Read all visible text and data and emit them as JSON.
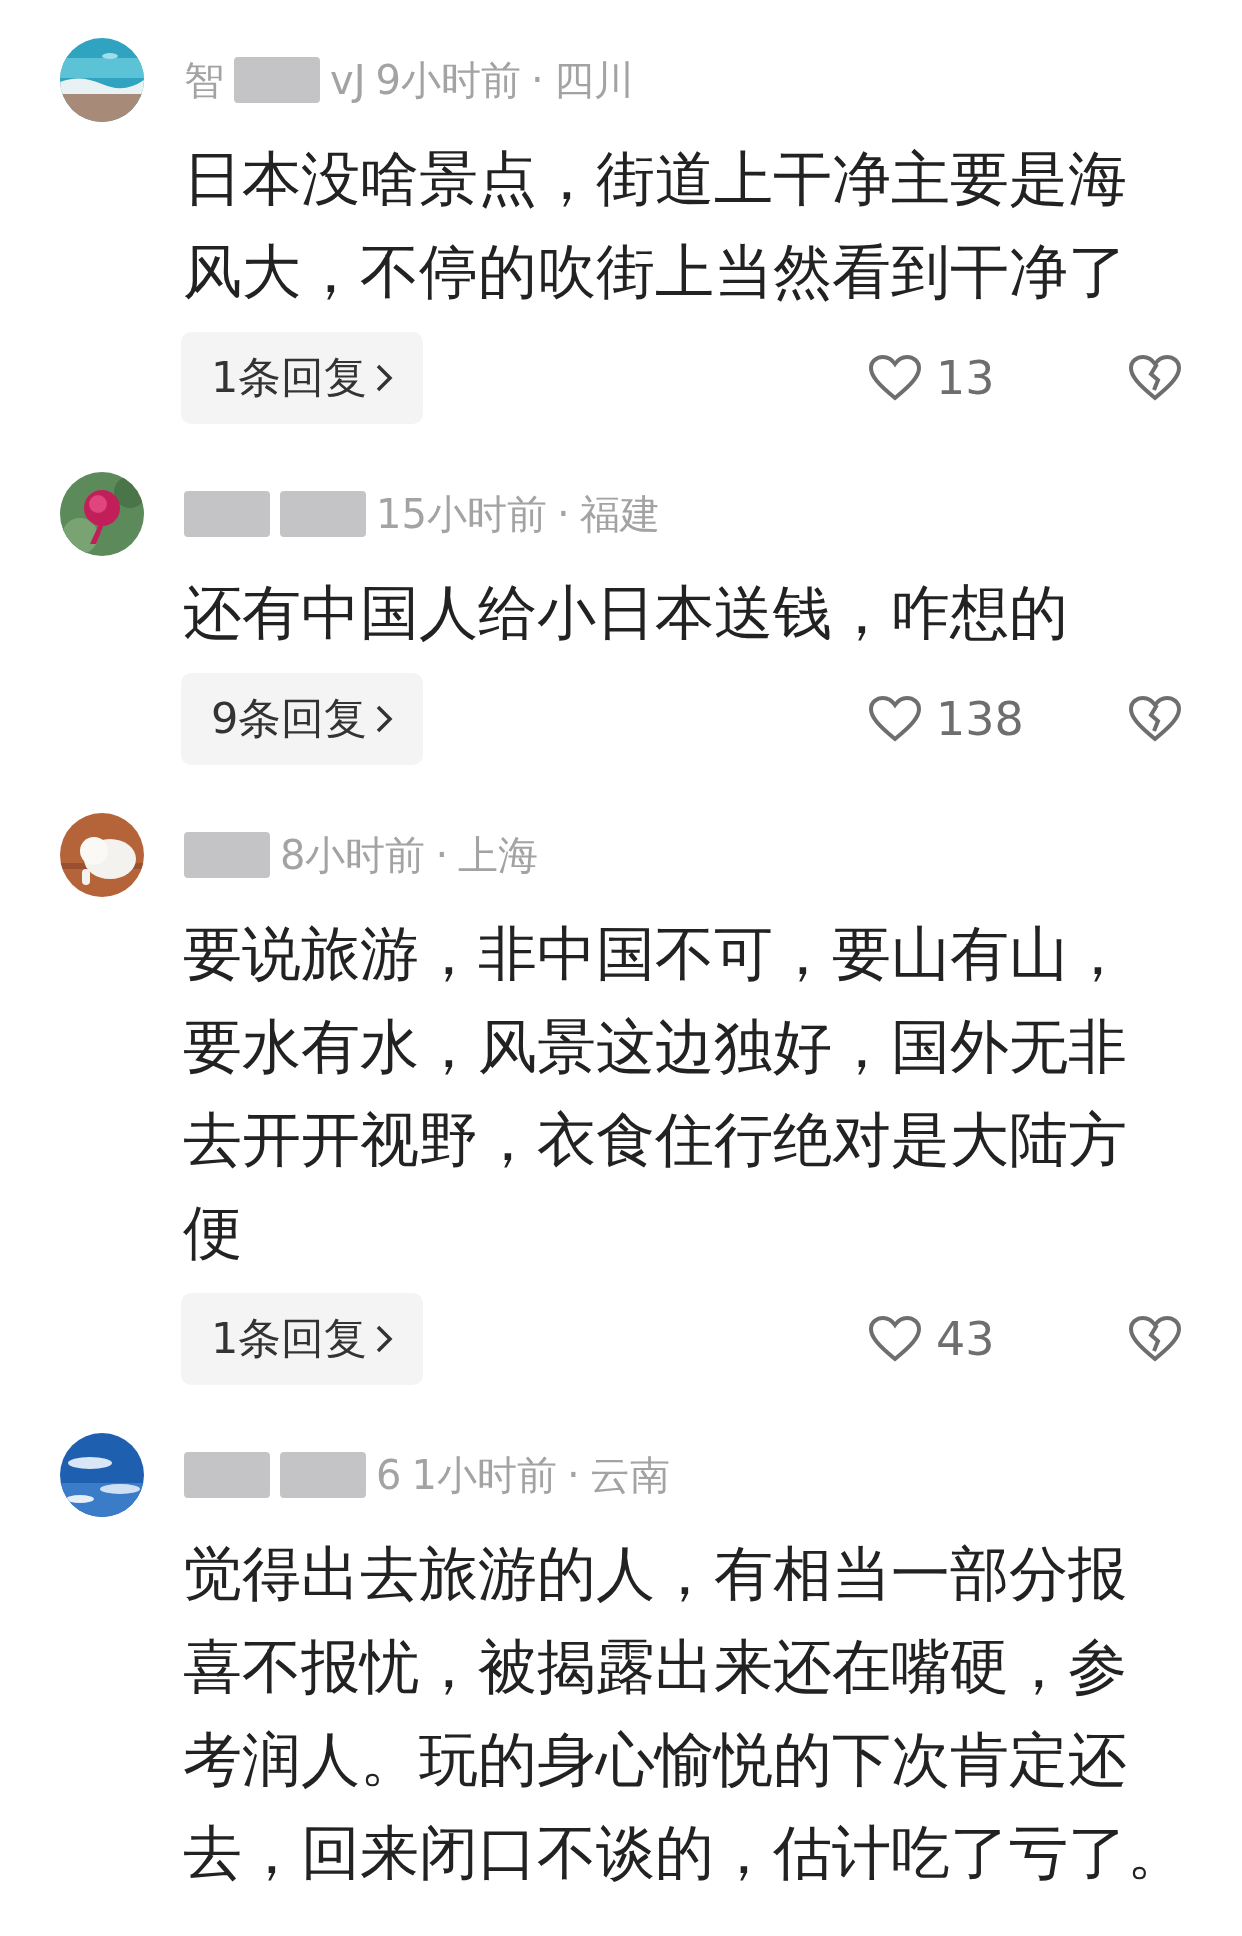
{
  "comments": [
    {
      "avatar": {
        "kind": "picture"
      },
      "name_parts": [
        {
          "kind": "text",
          "text": "智"
        },
        {
          "kind": "redacted"
        },
        {
          "kind": "text",
          "text": "vJ"
        }
      ],
      "time": "9小时前",
      "separator": "·",
      "location": "四川",
      "body_lines": [
        "日本没啥景点，街道上干净主要是海",
        "风大，不停的吹街上当然看到干净了"
      ],
      "replies": "1条回复",
      "likes": "13"
    },
    {
      "avatar": {
        "kind": "picture"
      },
      "name_parts": [
        {
          "kind": "redacted"
        },
        {
          "kind": "redacted"
        }
      ],
      "time": "15小时前",
      "separator": "·",
      "location": "福建",
      "body_lines": [
        "还有中国人给小日本送钱，咋想的"
      ],
      "replies": "9条回复",
      "likes": "138"
    },
    {
      "avatar": {
        "kind": "picture"
      },
      "name_parts": [
        {
          "kind": "redacted"
        }
      ],
      "time": "8小时前",
      "separator": "·",
      "location": "上海",
      "body_lines": [
        "要说旅游，非中国不可，要山有山，",
        "要水有水，风景这边独好，国外无非",
        "去开开视野，衣食住行绝对是大陆方",
        "便"
      ],
      "replies": "1条回复",
      "likes": "43"
    },
    {
      "avatar": {
        "kind": "picture"
      },
      "name_parts": [
        {
          "kind": "redacted"
        },
        {
          "kind": "redacted"
        },
        {
          "kind": "text",
          "text": "6"
        }
      ],
      "time": "1小时前",
      "separator": "·",
      "location": "云南",
      "body_lines": [
        "觉得出去旅游的人，有相当一部分报",
        "喜不报忧，被揭露出来还在嘴硬，参",
        "考润人。玩的身心愉悦的下次肯定还",
        "去，回来闭口不谈的，估计吃了亏了。"
      ]
    }
  ]
}
